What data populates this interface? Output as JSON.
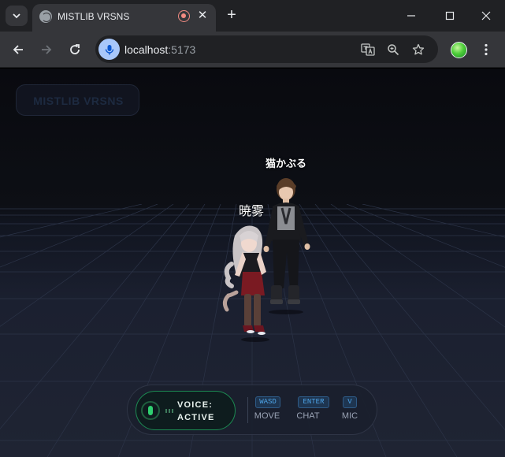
{
  "browser": {
    "tab_title": "MISTLIB VRSNS",
    "new_tab_symbol": "+",
    "close_symbol": "✕",
    "url_host": "localhost",
    "url_port": ":5173"
  },
  "scene": {
    "brand": "MISTLIB VRSNS",
    "avatars": [
      {
        "name": "猫かぶる"
      },
      {
        "name": "暁雾"
      }
    ]
  },
  "hud": {
    "voice_label": "VOICE:",
    "voice_status": "ACTIVE",
    "controls": [
      {
        "key": "WASD",
        "label": "MOVE"
      },
      {
        "key": "ENTER",
        "label": "CHAT"
      },
      {
        "key": "V",
        "label": "MIC"
      }
    ]
  },
  "colors": {
    "chrome_dark": "#202124",
    "chrome_mid": "#35363a",
    "voice_active": "#2fd070",
    "keycap_text": "#4da3e6"
  }
}
